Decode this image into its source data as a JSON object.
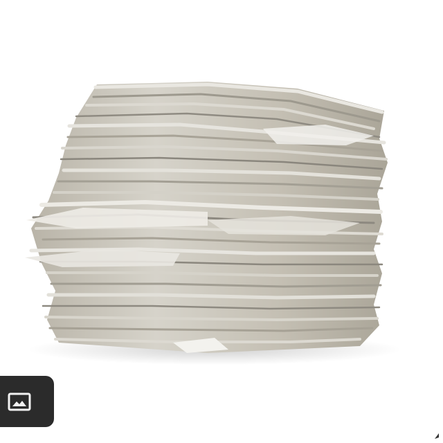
{
  "image": {
    "subject": "paper-stack",
    "background_color": "#ffffff",
    "paper_colors": [
      "#cfcbc0",
      "#bdb8ab",
      "#e3e1da",
      "#a9a498",
      "#d8d5cc",
      "#8f8b82"
    ]
  },
  "overlay": {
    "gallery_button": {
      "icon": "image-gallery-icon",
      "background": "#2b2b2b"
    },
    "corner_mark": {
      "icon": "corner-arrow-icon"
    }
  }
}
